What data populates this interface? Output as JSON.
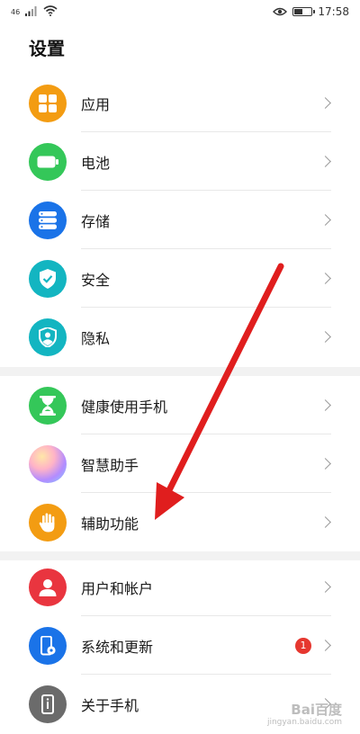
{
  "status_bar": {
    "signal_text": "46",
    "time": "17:58",
    "battery_level": 0.55
  },
  "page": {
    "title": "设置"
  },
  "groups": [
    {
      "items": [
        {
          "label": "应用",
          "icon": "apps-grid-icon",
          "color": "#f39c12"
        },
        {
          "label": "电池",
          "icon": "battery-icon",
          "color": "#34c759"
        },
        {
          "label": "存储",
          "icon": "storage-icon",
          "color": "#1a73e8"
        },
        {
          "label": "安全",
          "icon": "shield-check-icon",
          "color": "#13b5c1"
        },
        {
          "label": "隐私",
          "icon": "privacy-shield-icon",
          "color": "#13b5c1"
        }
      ]
    },
    {
      "items": [
        {
          "label": "健康使用手机",
          "icon": "hourglass-icon",
          "color": "#34c759"
        },
        {
          "label": "智慧助手",
          "icon": "assistant-orb-icon",
          "color": "#b38cff"
        },
        {
          "label": "辅助功能",
          "icon": "hand-icon",
          "color": "#f39c12"
        }
      ]
    },
    {
      "items": [
        {
          "label": "用户和帐户",
          "icon": "user-icon",
          "color": "#e9353f"
        },
        {
          "label": "系统和更新",
          "icon": "phone-settings-icon",
          "color": "#1a73e8",
          "badge": "1"
        },
        {
          "label": "关于手机",
          "icon": "phone-info-icon",
          "color": "#6b6b6b"
        }
      ]
    }
  ],
  "watermark": {
    "text": "Bai百度",
    "subtext": "jingyan.baidu.com"
  },
  "annotation_color": "#e01e1e"
}
